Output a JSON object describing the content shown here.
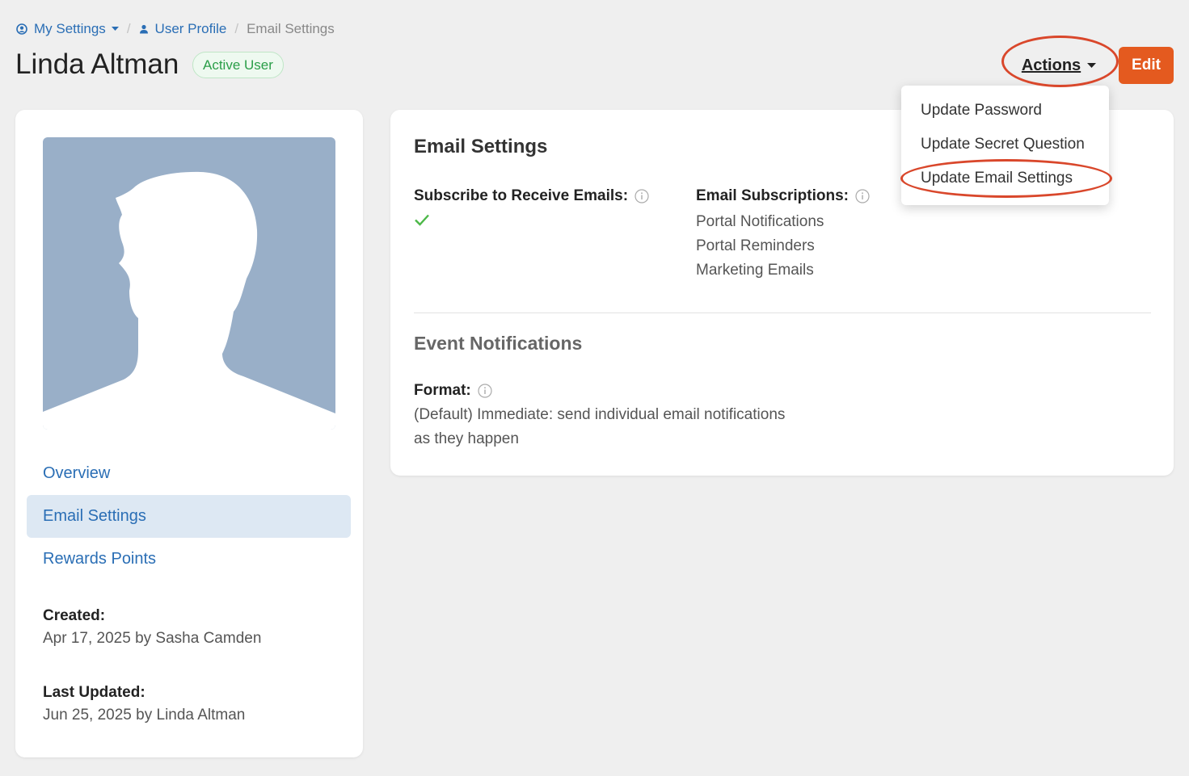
{
  "breadcrumb": {
    "my_settings": "My Settings",
    "user_profile": "User Profile",
    "current": "Email Settings",
    "separator": "/"
  },
  "header": {
    "name": "Linda Altman",
    "status": "Active User",
    "actions_label": "Actions",
    "edit_label": "Edit"
  },
  "actions_menu": {
    "items": [
      {
        "label": "Update Password"
      },
      {
        "label": "Update Secret Question"
      },
      {
        "label": "Update Email Settings"
      }
    ]
  },
  "sidebar": {
    "nav": [
      {
        "label": "Overview",
        "active": false
      },
      {
        "label": "Email Settings",
        "active": true
      },
      {
        "label": "Rewards Points",
        "active": false
      }
    ],
    "created_label": "Created:",
    "created_value": "Apr 17, 2025 by Sasha Camden",
    "updated_label": "Last Updated:",
    "updated_value": "Jun 25, 2025 by Linda Altman"
  },
  "email_settings": {
    "title": "Email Settings",
    "subscribe_label": "Subscribe to Receive Emails:",
    "subscribe_value": true,
    "subscriptions_label": "Email Subscriptions:",
    "subscriptions": [
      "Portal Notifications",
      "Portal Reminders",
      "Marketing Emails"
    ]
  },
  "event_notifications": {
    "title": "Event Notifications",
    "format_label": "Format:",
    "format_value": "(Default) Immediate: send individual email notifications as they happen"
  },
  "colors": {
    "link": "#2a6eb5",
    "primary_button": "#e45a1f",
    "active_badge": "#2a9e48",
    "annotation": "#d9472b",
    "avatar_bg": "#99afc8"
  },
  "icons": {
    "my_settings": "user-circle-icon",
    "user_profile": "person-icon",
    "info": "info-icon",
    "check": "check-icon",
    "caret": "caret-down-icon"
  }
}
